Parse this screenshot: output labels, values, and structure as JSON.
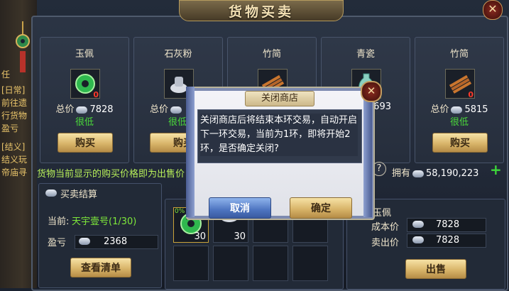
{
  "title": "货物买卖",
  "close_symbol": "✕",
  "side_texts": [
    "任",
    "[日常]",
    "前往遗",
    "行货物",
    "盈亏",
    "[结义]",
    "结义玩",
    "帝庙寻"
  ],
  "goods": [
    {
      "name": "玉佩",
      "icon": "jade-pendant-icon",
      "count": "0",
      "price_label": "总价",
      "price": "7828",
      "status": "很低",
      "buy_label": "购买"
    },
    {
      "name": "石灰粉",
      "icon": "lime-powder-icon",
      "count": "",
      "price_label": "总价",
      "price": "",
      "status": "很低",
      "buy_label": "购买"
    },
    {
      "name": "竹简",
      "icon": "bamboo-slip-icon",
      "count": "",
      "price_label": "",
      "price": "",
      "status": "",
      "buy_label": ""
    },
    {
      "name": "青瓷",
      "icon": "celadon-icon",
      "count": "",
      "price_label": "",
      "price": "4693",
      "status": "",
      "buy_label": ""
    },
    {
      "name": "竹简",
      "icon": "bamboo-slip-icon",
      "count": "0",
      "price_label": "总价",
      "price": "5815",
      "status": "很低",
      "buy_label": "购买"
    }
  ],
  "notice": "货物当前显示的购买价格即为出售价",
  "owned": {
    "label": "拥有",
    "value": "58,190,223",
    "plus": "+",
    "help": "?"
  },
  "settlement": {
    "title": "买卖结算",
    "current_label": "当前:",
    "current_value": "天宇壹号(1/30)",
    "profit_label": "盈亏",
    "profit_value": "2368",
    "view_list_label": "查看清单"
  },
  "inventory": {
    "slots": [
      {
        "count": "30"
      },
      {
        "count": "30"
      }
    ],
    "first_badge": "0%"
  },
  "sell_panel": {
    "item_name": "玉佩",
    "cost_label": "成本价",
    "cost_value": "7828",
    "sell_price_label": "卖出价",
    "sell_price_value": "7828",
    "sell_button": "出售"
  },
  "dialog": {
    "title": "关闭商店",
    "message": "关闭商店后将结束本环交易，自动开启下一环交易，当前为1环，即将开始2环，是否确定关闭?",
    "cancel": "取消",
    "confirm": "确定",
    "close": "✕"
  },
  "colors": {
    "status_low": "#4ad83a",
    "notice": "#b8f05a",
    "loss_count": "#ff3a2a",
    "gold_button": "#d9b56a",
    "blue_button": "#4d74c0"
  }
}
